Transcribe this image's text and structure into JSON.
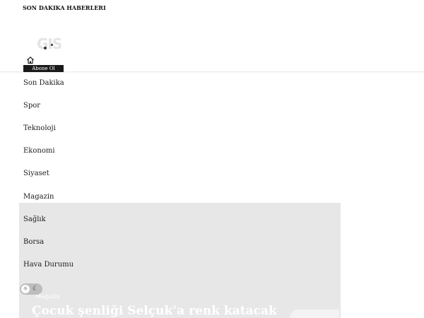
{
  "top_bar": {
    "breaking_label": "SON DAKIKA HABERLERI",
    "logo_text": "GIS"
  },
  "header": {
    "home_icon": "home-icon",
    "subscribe_label": "Abone Ol"
  },
  "menu": {
    "items": [
      {
        "label": "Son Dakika"
      },
      {
        "label": "Spor"
      },
      {
        "label": "Teknoloji"
      },
      {
        "label": "Ekonomi"
      },
      {
        "label": "Siyaset"
      },
      {
        "label": "Magazin"
      },
      {
        "label": "Sağlık"
      },
      {
        "label": "Borsa"
      },
      {
        "label": "Hava Durumu"
      }
    ]
  },
  "theme_toggle": {
    "sun_icon": "sun-icon",
    "moon_icon": "moon-icon"
  },
  "hero": {
    "category": "Magazin",
    "title": "Çocuk şenliği Selçuk’a renk katacak"
  },
  "colors": {
    "subscribe_bg": "#1a1a1a",
    "hero_bg": "#e7e7e7",
    "toggle_bg": "#bdbdbd"
  }
}
